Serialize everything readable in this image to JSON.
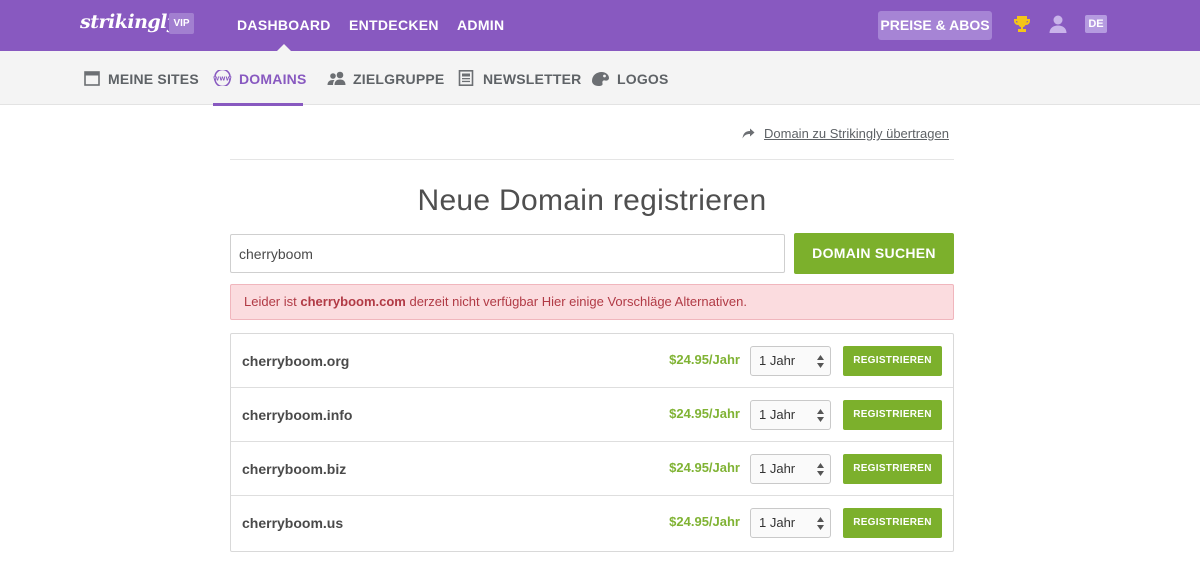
{
  "colors": {
    "topbar": "#8859c0",
    "accent": "#8859c0",
    "green": "#7cb02c",
    "price": "#80b334",
    "alert_bg": "#fbdcdf",
    "alert_text": "#b13a45"
  },
  "header": {
    "logo": "strikingly",
    "vip_badge": "VIP",
    "nav": [
      "DASHBOARD",
      "ENTDECKEN",
      "ADMIN"
    ],
    "active_nav": "DASHBOARD",
    "pricing_button": "PREISE & ABOS",
    "icons": [
      "trophy-icon",
      "user-icon"
    ],
    "language": "DE"
  },
  "subnav": {
    "items": [
      {
        "label": "MEINE SITES",
        "icon": "calendar-icon"
      },
      {
        "label": "DOMAINS",
        "icon": "www-icon"
      },
      {
        "label": "ZIELGRUPPE",
        "icon": "people-icon"
      },
      {
        "label": "NEWSLETTER",
        "icon": "newsletter-icon"
      },
      {
        "label": "LOGOS",
        "icon": "logo-icon"
      }
    ],
    "active": "DOMAINS"
  },
  "transfer_link": "Domain zu Strikingly übertragen",
  "page_title": "Neue Domain registrieren",
  "search": {
    "value": "cherryboom",
    "button": "DOMAIN SUCHEN"
  },
  "alert": {
    "prefix": "Leider ist ",
    "domain": "cherryboom.com",
    "suffix": " derzeit nicht verfügbar Hier einige Vorschläge Alternativen."
  },
  "results": [
    {
      "domain": "cherryboom.org",
      "price": "$24.95/Jahr",
      "period": "1 Jahr",
      "button": "REGISTRIEREN"
    },
    {
      "domain": "cherryboom.info",
      "price": "$24.95/Jahr",
      "period": "1 Jahr",
      "button": "REGISTRIEREN"
    },
    {
      "domain": "cherryboom.biz",
      "price": "$24.95/Jahr",
      "period": "1 Jahr",
      "button": "REGISTRIEREN"
    },
    {
      "domain": "cherryboom.us",
      "price": "$24.95/Jahr",
      "period": "1 Jahr",
      "button": "REGISTRIEREN"
    }
  ]
}
